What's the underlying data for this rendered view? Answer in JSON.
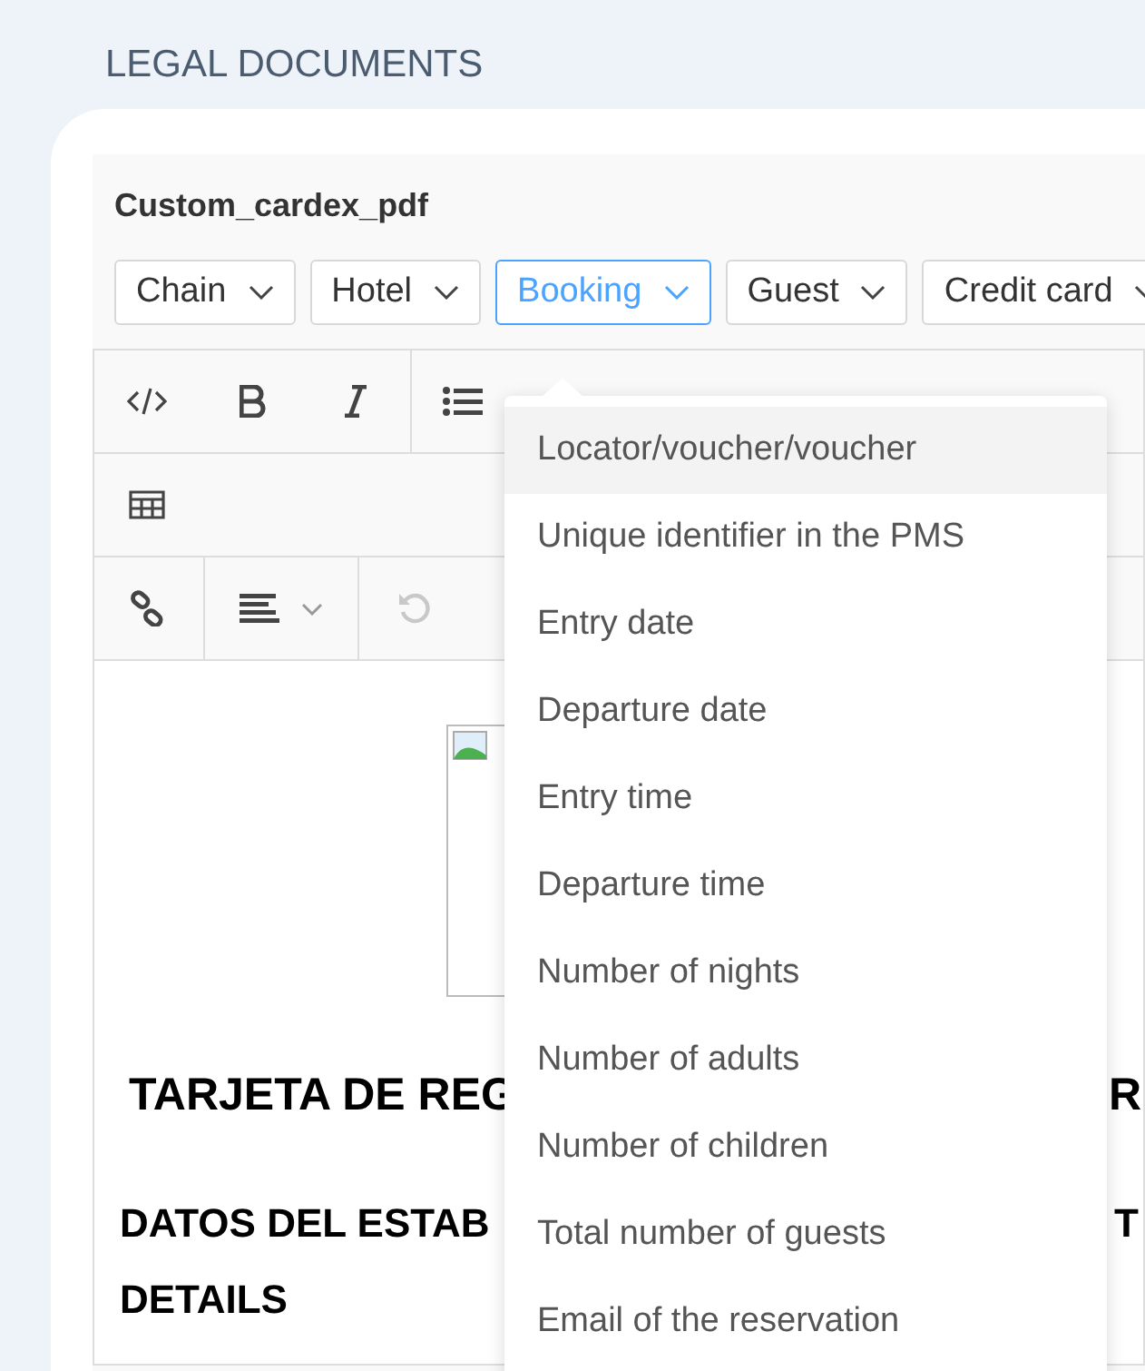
{
  "page_title": "LEGAL DOCUMENTS",
  "document_title": "Custom_cardex_pdf",
  "filters": [
    {
      "label": "Chain",
      "selected": false
    },
    {
      "label": "Hotel",
      "selected": false
    },
    {
      "label": "Booking",
      "selected": true
    },
    {
      "label": "Guest",
      "selected": false
    },
    {
      "label": "Credit card",
      "selected": false
    }
  ],
  "toolbar_rows": [
    [
      {
        "kind": "code",
        "disabled": false
      },
      {
        "kind": "bold",
        "disabled": false
      },
      {
        "kind": "italic",
        "disabled": false
      },
      {
        "kind": "list",
        "disabled": false
      }
    ],
    [
      {
        "kind": "table",
        "disabled": false
      }
    ],
    [
      {
        "kind": "link",
        "disabled": false
      },
      {
        "kind": "align",
        "disabled": false
      },
      {
        "kind": "undo",
        "disabled": true
      }
    ]
  ],
  "document": {
    "heading_left": "TARJETA DE REG",
    "heading_right": "R",
    "section_left": "DATOS DEL ESTAB",
    "section_right": "T",
    "section_line2": "DETAILS"
  },
  "menu_items": [
    {
      "label": "Locator/voucher/voucher",
      "selected": true
    },
    {
      "label": "Unique identifier in the PMS",
      "selected": false
    },
    {
      "label": "Entry date",
      "selected": false
    },
    {
      "label": "Departure date",
      "selected": false
    },
    {
      "label": "Entry time",
      "selected": false
    },
    {
      "label": "Departure time",
      "selected": false
    },
    {
      "label": "Number of nights",
      "selected": false
    },
    {
      "label": "Number of adults",
      "selected": false
    },
    {
      "label": "Number of children",
      "selected": false
    },
    {
      "label": "Total number of guests",
      "selected": false
    },
    {
      "label": "Email of the reservation",
      "selected": false
    }
  ]
}
